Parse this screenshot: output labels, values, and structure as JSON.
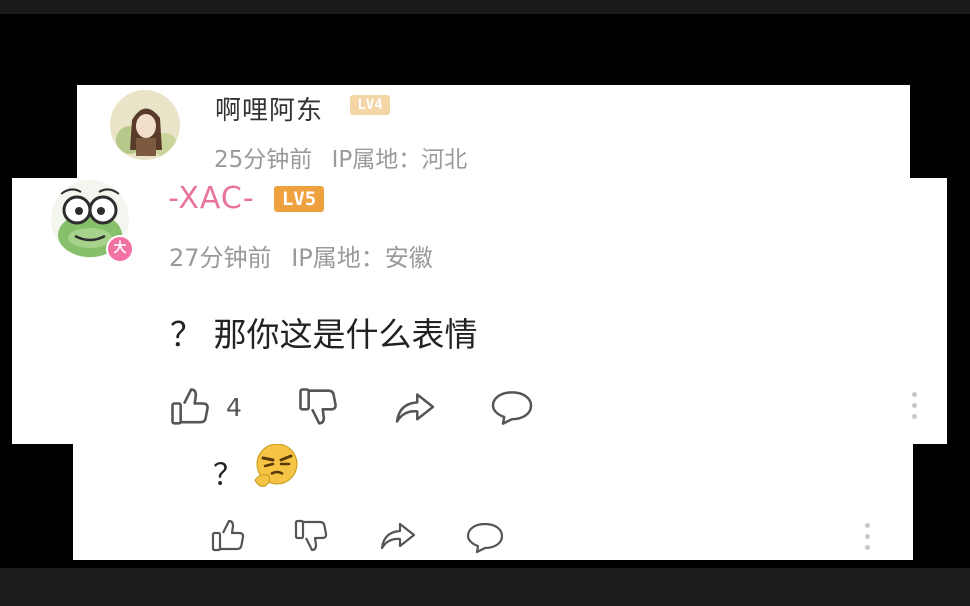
{
  "reply_above": {
    "username": "啊哩阿东",
    "level": "LV4",
    "time": "25分钟前",
    "ip_location": "IP属地：河北"
  },
  "comment": {
    "username": "-XAC-",
    "level": "LV5",
    "badge": "大",
    "time": "27分钟前",
    "ip_location": "IP属地：安徽",
    "text": "？ 那你这是什么表情",
    "like_count": "4"
  },
  "reply_below": {
    "text": "？"
  },
  "colors": {
    "username_pink": "#e8749a",
    "level_lv4": "#f4d5a6",
    "level_lv5": "#f0a13f",
    "badge": "#f272a3",
    "icon_stroke": "#555555"
  }
}
